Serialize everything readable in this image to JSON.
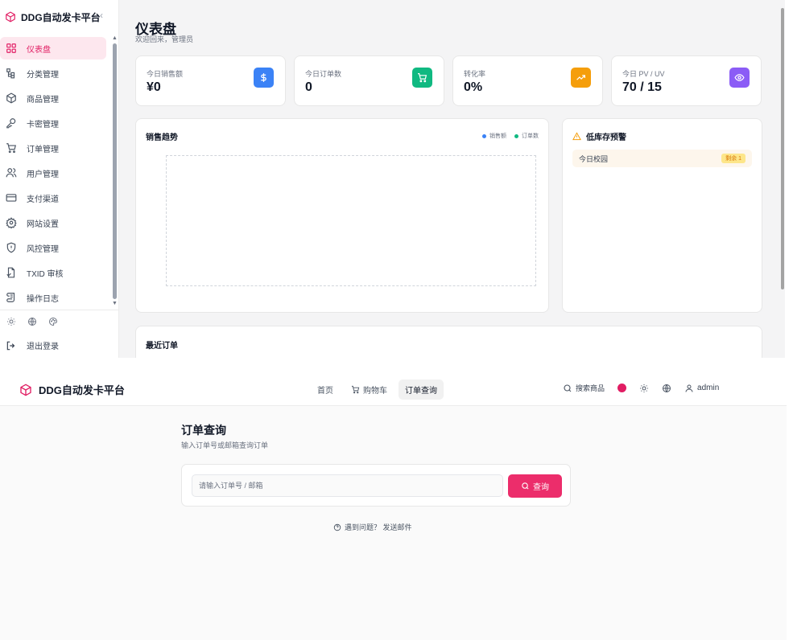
{
  "admin": {
    "brand": "DDG自动发卡平台",
    "collapse_glyph": "‹",
    "nav": [
      {
        "label": "仪表盘",
        "icon": "dashboard-icon",
        "active": true
      },
      {
        "label": "分类管理",
        "icon": "category-icon"
      },
      {
        "label": "商品管理",
        "icon": "package-icon"
      },
      {
        "label": "卡密管理",
        "icon": "key-icon"
      },
      {
        "label": "订单管理",
        "icon": "cart-icon"
      },
      {
        "label": "用户管理",
        "icon": "users-icon"
      },
      {
        "label": "支付渠道",
        "icon": "credit-card-icon"
      },
      {
        "label": "网站设置",
        "icon": "gear-icon"
      },
      {
        "label": "风控管理",
        "icon": "shield-icon"
      },
      {
        "label": "TXID 审核",
        "icon": "file-check-icon"
      },
      {
        "label": "操作日志",
        "icon": "scroll-icon"
      }
    ],
    "logout_label": "退出登录",
    "page_title": "仪表盘",
    "page_subtitle": "欢迎回来，管理员",
    "stats": [
      {
        "label": "今日销售额",
        "value": "¥0",
        "icon": "dollar-icon",
        "color": "#3b82f6"
      },
      {
        "label": "今日订单数",
        "value": "0",
        "icon": "cart-icon",
        "color": "#10b981"
      },
      {
        "label": "转化率",
        "value": "0%",
        "icon": "trend-up-icon",
        "color": "#f59e0b"
      },
      {
        "label": "今日 PV / UV",
        "value": "70 / 15",
        "icon": "eye-icon",
        "color": "#8b5cf6"
      }
    ],
    "sales_trend": {
      "title": "销售趋势",
      "legend": [
        {
          "name": "销售额",
          "color": "#3b82f6"
        },
        {
          "name": "订单数",
          "color": "#10b981"
        }
      ]
    },
    "low_stock": {
      "title": "低库存预警",
      "items": [
        {
          "name": "今日校园",
          "badge": "剩余 1"
        }
      ]
    },
    "recent_orders_title": "最近订单"
  },
  "storefront": {
    "brand": "DDG自动发卡平台",
    "nav": [
      {
        "label": "首页"
      },
      {
        "label": "购物车",
        "icon": "cart-icon"
      },
      {
        "label": "订单查询",
        "active": true
      }
    ],
    "search_label": "搜索商品",
    "user_label": "admin",
    "query_title": "订单查询",
    "query_subtitle": "输入订单号或邮箱查询订单",
    "query_placeholder": "请输入订单号 / 邮箱",
    "query_button": "查询",
    "help_text": "遇到问题？ 发送邮件"
  }
}
